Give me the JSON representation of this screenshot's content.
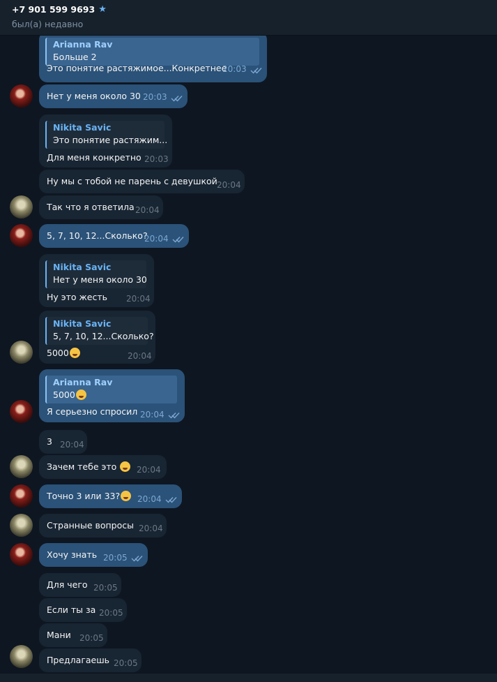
{
  "header": {
    "title": "+7 901 599 9693",
    "status": "был(а) недавно"
  },
  "messages": [
    {
      "reply_name": "Arianna Rav",
      "reply_text": "Больше 2",
      "text": "Это понятие растяжимое...Конкретнее",
      "time": "20:03",
      "read": true
    },
    {
      "text": "Нет у меня около 30",
      "time": "20:03",
      "read": true
    },
    {
      "reply_name": "Nikita Savic",
      "reply_text": "Это понятие растяжим...",
      "text": "Для меня конкретно",
      "time": "20:03"
    },
    {
      "text": "Ну мы с тобой не парень с девушкой",
      "time": "20:04"
    },
    {
      "text": "Так что я ответила",
      "time": "20:04"
    },
    {
      "text": "5, 7, 10, 12...Сколько?",
      "time": "20:04",
      "read": true
    },
    {
      "reply_name": "Nikita Savic",
      "reply_text": "Нет у меня около 30",
      "text": "Ну это жесть",
      "time": "20:04"
    },
    {
      "reply_name": "Nikita Savic",
      "reply_text": "5, 7, 10, 12...Сколько?",
      "text": "5000",
      "time": "20:04"
    },
    {
      "reply_name": "Arianna Rav",
      "reply_text": "5000",
      "text": "Я серьезно спросил",
      "time": "20:04",
      "read": true
    },
    {
      "text": "3",
      "time": "20:04"
    },
    {
      "text": "Зачем тебе это",
      "time": "20:04"
    },
    {
      "text": "Точно 3 или 33?",
      "time": "20:04",
      "read": true
    },
    {
      "text": "Странные вопросы",
      "time": "20:04"
    },
    {
      "text": "Хочу знать",
      "time": "20:05",
      "read": true
    },
    {
      "text": "Для чего",
      "time": "20:05"
    },
    {
      "text": "Если ты за",
      "time": "20:05"
    },
    {
      "text": "Мани",
      "time": "20:05"
    },
    {
      "text": "Предлагаешь",
      "time": "20:05"
    }
  ],
  "colors": {
    "incoming": "#182533",
    "outgoing": "#2b5278",
    "accent": "#6ab3f3",
    "background": "#0e1621"
  },
  "icons": [
    "star-icon",
    "double-check-icon",
    "avatar",
    "emoji"
  ]
}
